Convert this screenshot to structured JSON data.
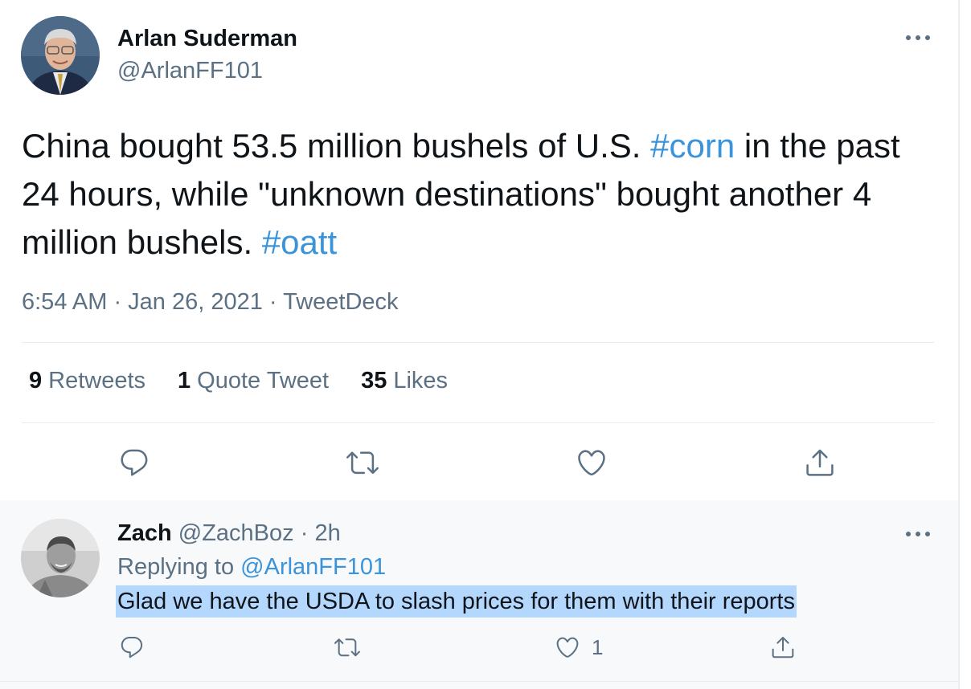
{
  "tweet": {
    "author_name": "Arlan Suderman",
    "author_handle": "@ArlanFF101",
    "text_parts": {
      "p1": "China bought 53.5 million bushels of U.S. ",
      "tag1": "#corn",
      "p2": " in the past 24 hours, while \"unknown destinations\" bought another 4 million bushels. ",
      "tag2": "#oatt"
    },
    "meta": "6:54 AM · Jan 26, 2021 · TweetDeck",
    "stats": {
      "retweets_count": "9",
      "retweets_label": "Retweets",
      "quotes_count": "1",
      "quotes_label": "Quote Tweet",
      "likes_count": "35",
      "likes_label": "Likes"
    },
    "actions": [
      "reply-icon",
      "retweet-icon",
      "like-icon",
      "share-icon"
    ]
  },
  "reply": {
    "author_name": "Zach",
    "author_handle": "@ZachBoz",
    "separator": "·",
    "time": "2h",
    "replying_label": "Replying to",
    "replying_to": "@ArlanFF101",
    "text": "Glad we have the USDA to slash prices for them with their reports",
    "like_count": "1"
  },
  "colors": {
    "link": "#3b94d9",
    "secondary_text": "#5b7083",
    "selection": "#b4d7fe",
    "reply_background": "#f7f9fa"
  }
}
